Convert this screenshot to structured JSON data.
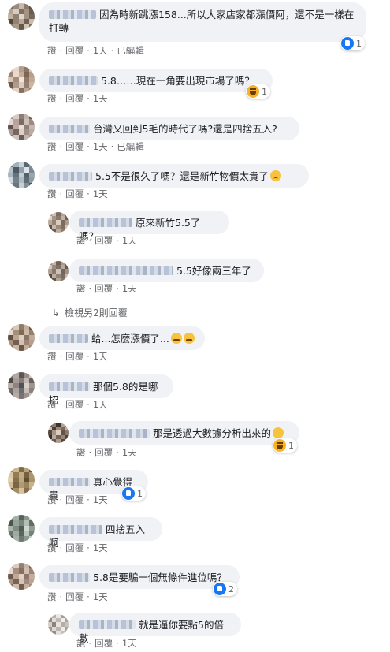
{
  "actions": {
    "like": "讚",
    "reply": "回覆",
    "time": "1天",
    "edited": "已編輯",
    "dot": "·"
  },
  "comments": [
    {
      "text": "因為時新跳漲158...所以大家店家都漲價阿，還不是一樣在打轉",
      "reactions": "1",
      "edited": true
    },
    {
      "text": "5.8……現在一角要出現市場了嗎？",
      "reactions": "1",
      "edited": false
    },
    {
      "text": "台灣又回到5毛的時代了嗎?還是四捨五入?",
      "edited": true
    },
    {
      "text": "5.5不是很久了嗎？還是新竹物價太貴了",
      "edited": false
    },
    {
      "text": "原來新竹5.5了嗎？"
    },
    {
      "text": "5.5好像兩三年了"
    },
    {
      "text": "蛤...怎麼漲價了..."
    },
    {
      "text": "那個5.8的是哪招"
    },
    {
      "text": "那是透過大數據分析出來的",
      "reactions": "1"
    },
    {
      "text": "真心覺得貴",
      "reactions": "1"
    },
    {
      "text": "四捨五入啊"
    },
    {
      "text": "5.8是要騙一個無條件進位嗎？",
      "reactions": "2"
    },
    {
      "text": "就是逼你要點5的倍數"
    }
  ],
  "more_replies": "檢視另2則回覆",
  "colors": {
    "bubble": "#f0f2f5",
    "link": "#65676b",
    "like": "#1877f2",
    "haha": "#f7b125"
  },
  "icons": {
    "like": "like-icon",
    "haha": "haha-icon",
    "reply_arrow": "reply-arrow-icon"
  }
}
